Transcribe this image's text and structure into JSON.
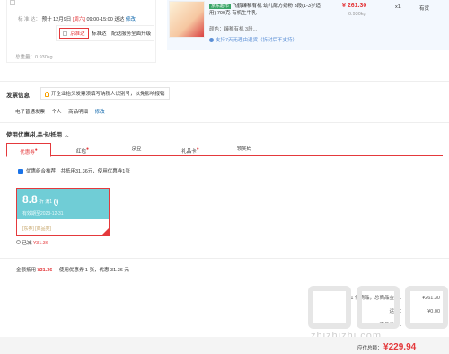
{
  "shipping": {
    "label": "标 准 达：",
    "estimate": "预计 12月9日",
    "weekday": "[周六]",
    "time": "09:00-15:00 送达",
    "edit": "修改",
    "options": [
      "京准达",
      "标准达",
      "配送服务全面升级"
    ]
  },
  "item": {
    "tag": "京东超市",
    "title": "飞鹤臻稚有机 幼儿配方奶粉 3段(1-3岁适用) 700克 有机生牛乳",
    "color_label": "颜色：臻稚有机 3段...",
    "service": "支持7天无理由退货（拆封后不支持）",
    "price": "¥ 261.30",
    "weight": "0.930kg",
    "qty": "x1",
    "stock": "有货"
  },
  "total_weight": "总重量：0.930kg",
  "invoice": {
    "title": "发票信息",
    "notice": "开企业抬头发票须填写纳税人识别号，以免影响报销",
    "type": "电子普通发票",
    "person": "个人",
    "detail": "商品明细",
    "edit": "修改"
  },
  "coupons": {
    "title": "使用优惠/礼品卡/抵用",
    "tabs": [
      "优惠券",
      "红包",
      "京豆",
      "礼品卡",
      "领奖码"
    ],
    "recommend": "优惠组合推荐，共抵用31.36元，使用优惠券1张",
    "card": {
      "discount": "8.8",
      "unit": "折",
      "condition": "满1",
      "validity": "有效期至2023-12-31",
      "tags": "[东券]  [商品类]"
    },
    "used_label": "已减",
    "used_amount": "¥31.36",
    "total_label": "金额抵用",
    "total_amount": "¥31.36",
    "total_desc": "使用优惠券 1 张，优惠 31.36 元"
  },
  "summary": {
    "rows": [
      {
        "label": "1 件商品，总商品金额：",
        "value": "¥261.30"
      },
      {
        "label": "运费：",
        "value": "¥0.00"
      },
      {
        "label": "商品优惠：",
        "value": "-¥31.36"
      }
    ]
  },
  "bottom": {
    "payable_label": "应付总额：",
    "payable": "¥229.94"
  },
  "watermark": "zhizhizhi.com"
}
